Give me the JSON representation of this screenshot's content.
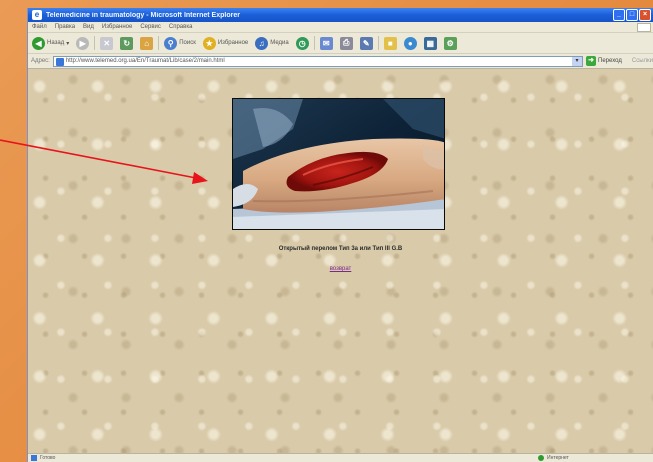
{
  "window": {
    "title": "Telemedicine in traumatology - Microsoft Internet Explorer",
    "ie_logo": "e",
    "minimize": "_",
    "maximize": "□",
    "close": "×"
  },
  "menubar": {
    "items": [
      "Файл",
      "Правка",
      "Вид",
      "Избранное",
      "Сервис",
      "Справка"
    ]
  },
  "toolbar": {
    "back_label": "Назад",
    "search_label": "Поиск",
    "favorites_label": "Избранное",
    "media_label": "Медиа"
  },
  "address": {
    "label": "Адрес:",
    "url": "http://www.telemed.org.ua/En/Traumat/Lib/case/2/main.html",
    "go_label": "Переход",
    "links_label": "Ссылки"
  },
  "content": {
    "caption": "Открытый перелом Тип 3a или Тип III G.B",
    "back_link": "возврат"
  },
  "statusbar": {
    "left_text": "Готово",
    "zone_text": "Интернет"
  },
  "colors": {
    "desktop": "#e48a3e",
    "titlebar": "#1a5fd8",
    "arrow": "#e8141c",
    "link": "#7a2a8a"
  }
}
